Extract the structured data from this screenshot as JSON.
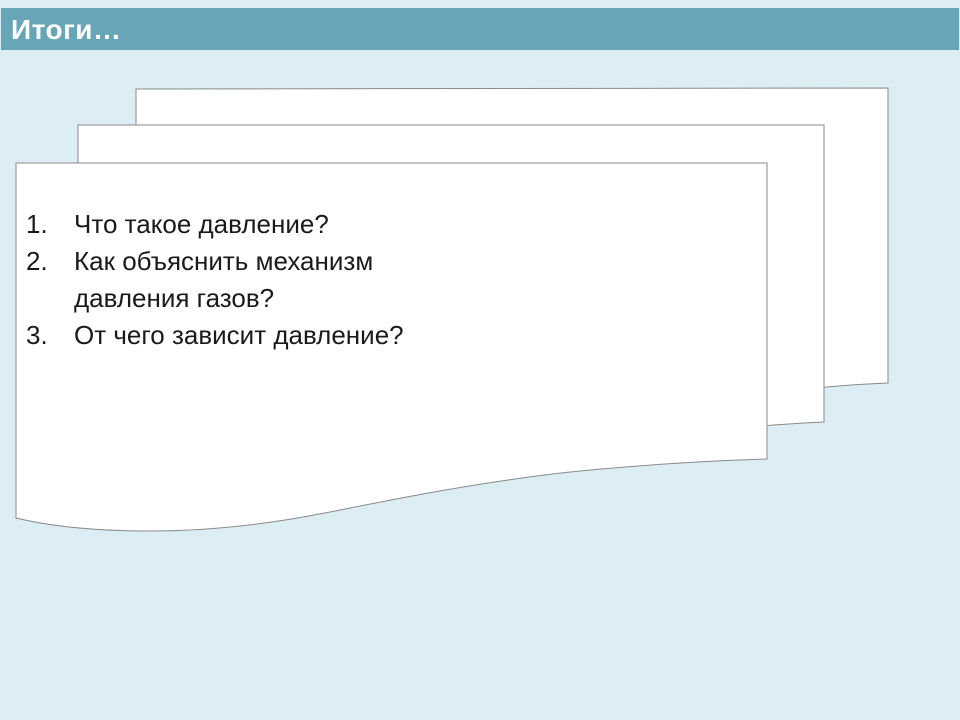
{
  "slide": {
    "title": "Итоги…",
    "items": [
      {
        "number": "1.",
        "text": "Что такое давление?"
      },
      {
        "number": "2.",
        "text": "Как объяснить механизм давления газов?"
      },
      {
        "number": "3.",
        "text": "От чего зависит давление?"
      }
    ]
  },
  "colors": {
    "background": "#dcedf3",
    "title_bar": "#67a5b7",
    "title_text": "#ffffff",
    "paper": "#ffffff",
    "paper_border": "#8a8a8a"
  }
}
